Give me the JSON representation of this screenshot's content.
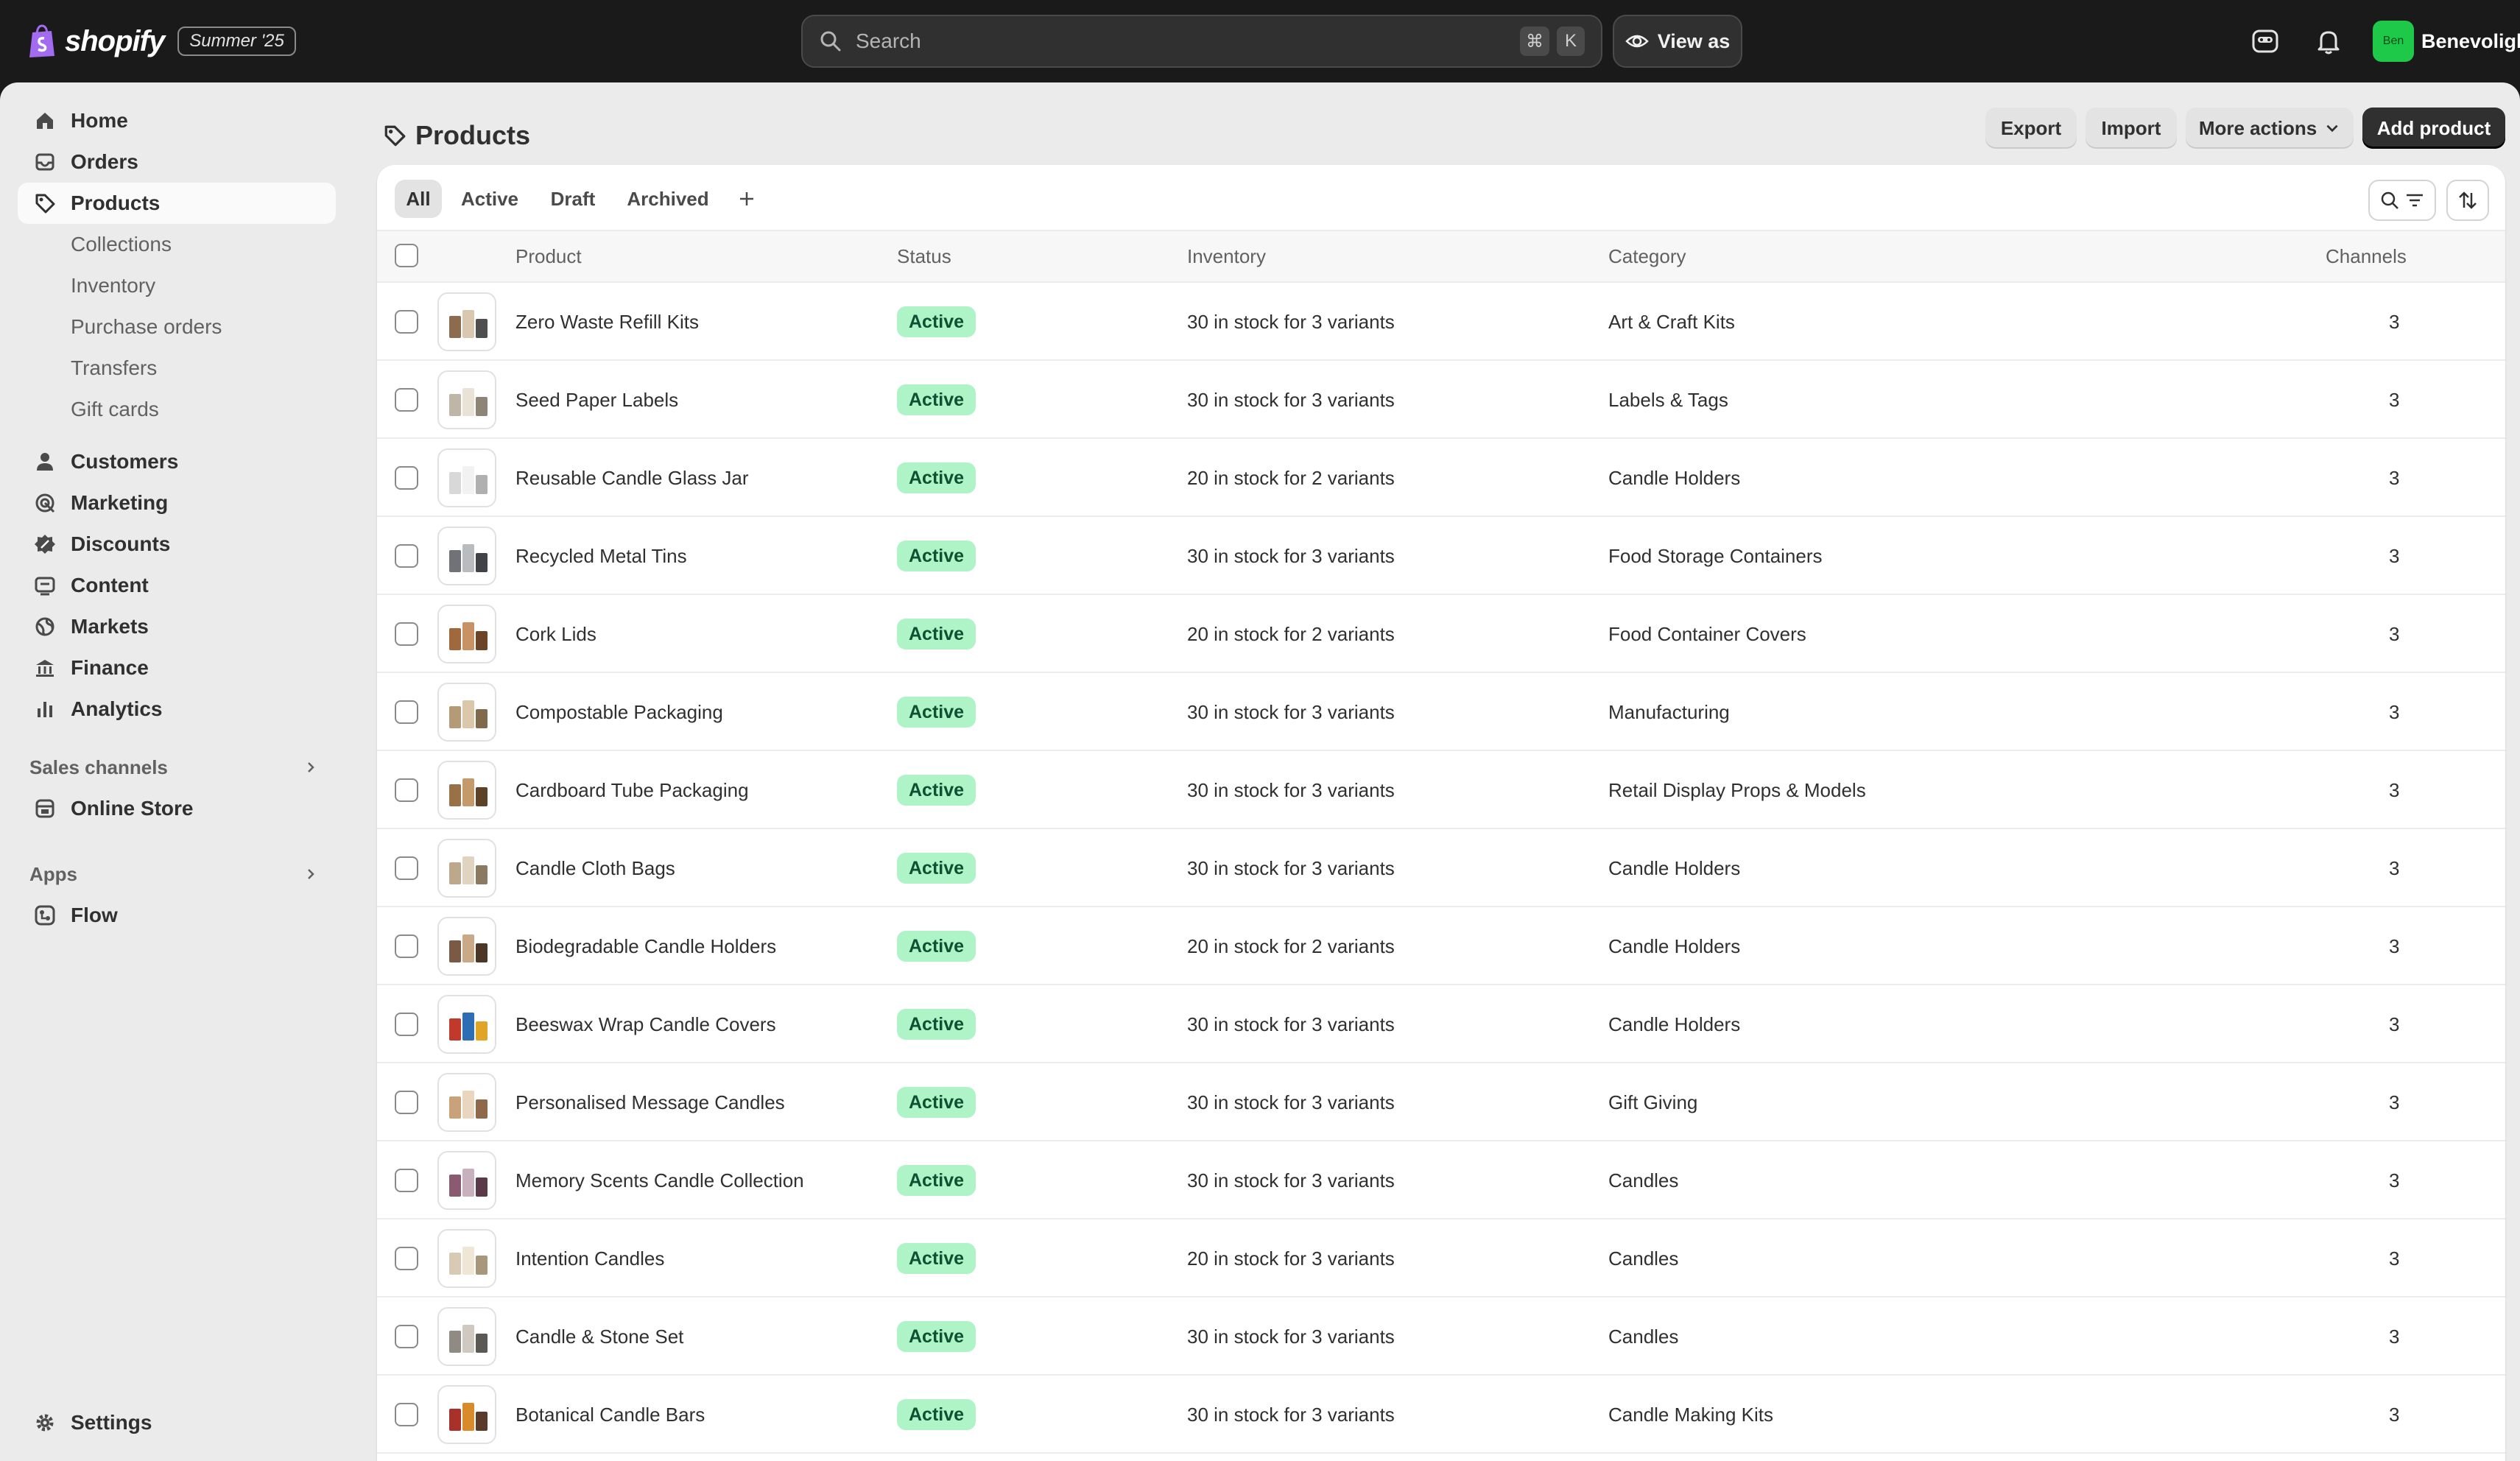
{
  "topbar": {
    "brand": "shopify",
    "edition_badge": "Summer '25",
    "search_placeholder": "Search",
    "shortcut_keys": [
      "⌘",
      "K"
    ],
    "view_as_label": "View as",
    "avatar_initials": "Ben",
    "store_name": "Benevolight"
  },
  "sidebar": {
    "items": [
      {
        "label": "Home",
        "icon": "home-icon"
      },
      {
        "label": "Orders",
        "icon": "inbox-icon"
      },
      {
        "label": "Products",
        "icon": "tag-icon",
        "active": true
      }
    ],
    "product_subitems": [
      "Collections",
      "Inventory",
      "Purchase orders",
      "Transfers",
      "Gift cards"
    ],
    "items2": [
      {
        "label": "Customers",
        "icon": "person-icon"
      },
      {
        "label": "Marketing",
        "icon": "target-icon"
      },
      {
        "label": "Discounts",
        "icon": "discount-icon"
      },
      {
        "label": "Content",
        "icon": "content-icon"
      },
      {
        "label": "Markets",
        "icon": "globe-icon"
      },
      {
        "label": "Finance",
        "icon": "bank-icon"
      },
      {
        "label": "Analytics",
        "icon": "bar-chart-icon"
      }
    ],
    "sales_channels_heading": "Sales channels",
    "sales_channels": [
      {
        "label": "Online Store",
        "icon": "store-icon"
      }
    ],
    "apps_heading": "Apps",
    "apps": [
      {
        "label": "Flow",
        "icon": "flow-icon"
      }
    ],
    "settings_label": "Settings"
  },
  "page": {
    "title": "Products",
    "actions": {
      "export": "Export",
      "import": "Import",
      "more": "More actions",
      "add": "Add product"
    },
    "tabs": [
      "All",
      "Active",
      "Draft",
      "Archived"
    ],
    "active_tab": "All"
  },
  "table": {
    "columns": {
      "product": "Product",
      "status": "Status",
      "inventory": "Inventory",
      "category": "Category",
      "channels": "Channels"
    },
    "rows": [
      {
        "product": "Zero Waste Refill Kits",
        "status": "Active",
        "inventory": "30 in stock for 3 variants",
        "category": "Art & Craft Kits",
        "channels": "3"
      },
      {
        "product": "Seed Paper Labels",
        "status": "Active",
        "inventory": "30 in stock for 3 variants",
        "category": "Labels & Tags",
        "channels": "3"
      },
      {
        "product": "Reusable Candle Glass Jar",
        "status": "Active",
        "inventory": "20 in stock for 2 variants",
        "category": "Candle Holders",
        "channels": "3"
      },
      {
        "product": "Recycled Metal Tins",
        "status": "Active",
        "inventory": "30 in stock for 3 variants",
        "category": "Food Storage Containers",
        "channels": "3"
      },
      {
        "product": "Cork Lids",
        "status": "Active",
        "inventory": "20 in stock for 2 variants",
        "category": "Food Container Covers",
        "channels": "3"
      },
      {
        "product": "Compostable Packaging",
        "status": "Active",
        "inventory": "30 in stock for 3 variants",
        "category": "Manufacturing",
        "channels": "3"
      },
      {
        "product": "Cardboard Tube Packaging",
        "status": "Active",
        "inventory": "30 in stock for 3 variants",
        "category": "Retail Display Props & Models",
        "channels": "3"
      },
      {
        "product": "Candle Cloth Bags",
        "status": "Active",
        "inventory": "30 in stock for 3 variants",
        "category": "Candle Holders",
        "channels": "3"
      },
      {
        "product": "Biodegradable Candle Holders",
        "status": "Active",
        "inventory": "20 in stock for 2 variants",
        "category": "Candle Holders",
        "channels": "3"
      },
      {
        "product": "Beeswax Wrap Candle Covers",
        "status": "Active",
        "inventory": "30 in stock for 3 variants",
        "category": "Candle Holders",
        "channels": "3"
      },
      {
        "product": "Personalised Message Candles",
        "status": "Active",
        "inventory": "30 in stock for 3 variants",
        "category": "Gift Giving",
        "channels": "3"
      },
      {
        "product": "Memory Scents Candle Collection",
        "status": "Active",
        "inventory": "30 in stock for 3 variants",
        "category": "Candles",
        "channels": "3"
      },
      {
        "product": "Intention Candles",
        "status": "Active",
        "inventory": "20 in stock for 3 variants",
        "category": "Candles",
        "channels": "3"
      },
      {
        "product": "Candle & Stone Set",
        "status": "Active",
        "inventory": "30 in stock for 3 variants",
        "category": "Candles",
        "channels": "3"
      },
      {
        "product": "Botanical Candle Bars",
        "status": "Active",
        "inventory": "30 in stock for 3 variants",
        "category": "Candle Making Kits",
        "channels": "3"
      }
    ]
  },
  "colors": {
    "topbar_bg": "#1a1a1a",
    "sidebar_bg": "#ebebeb",
    "primary_button": "#303030",
    "active_badge_bg": "#aff4c6",
    "active_badge_text": "#0c5132",
    "avatar_bg": "#1ec94a"
  }
}
